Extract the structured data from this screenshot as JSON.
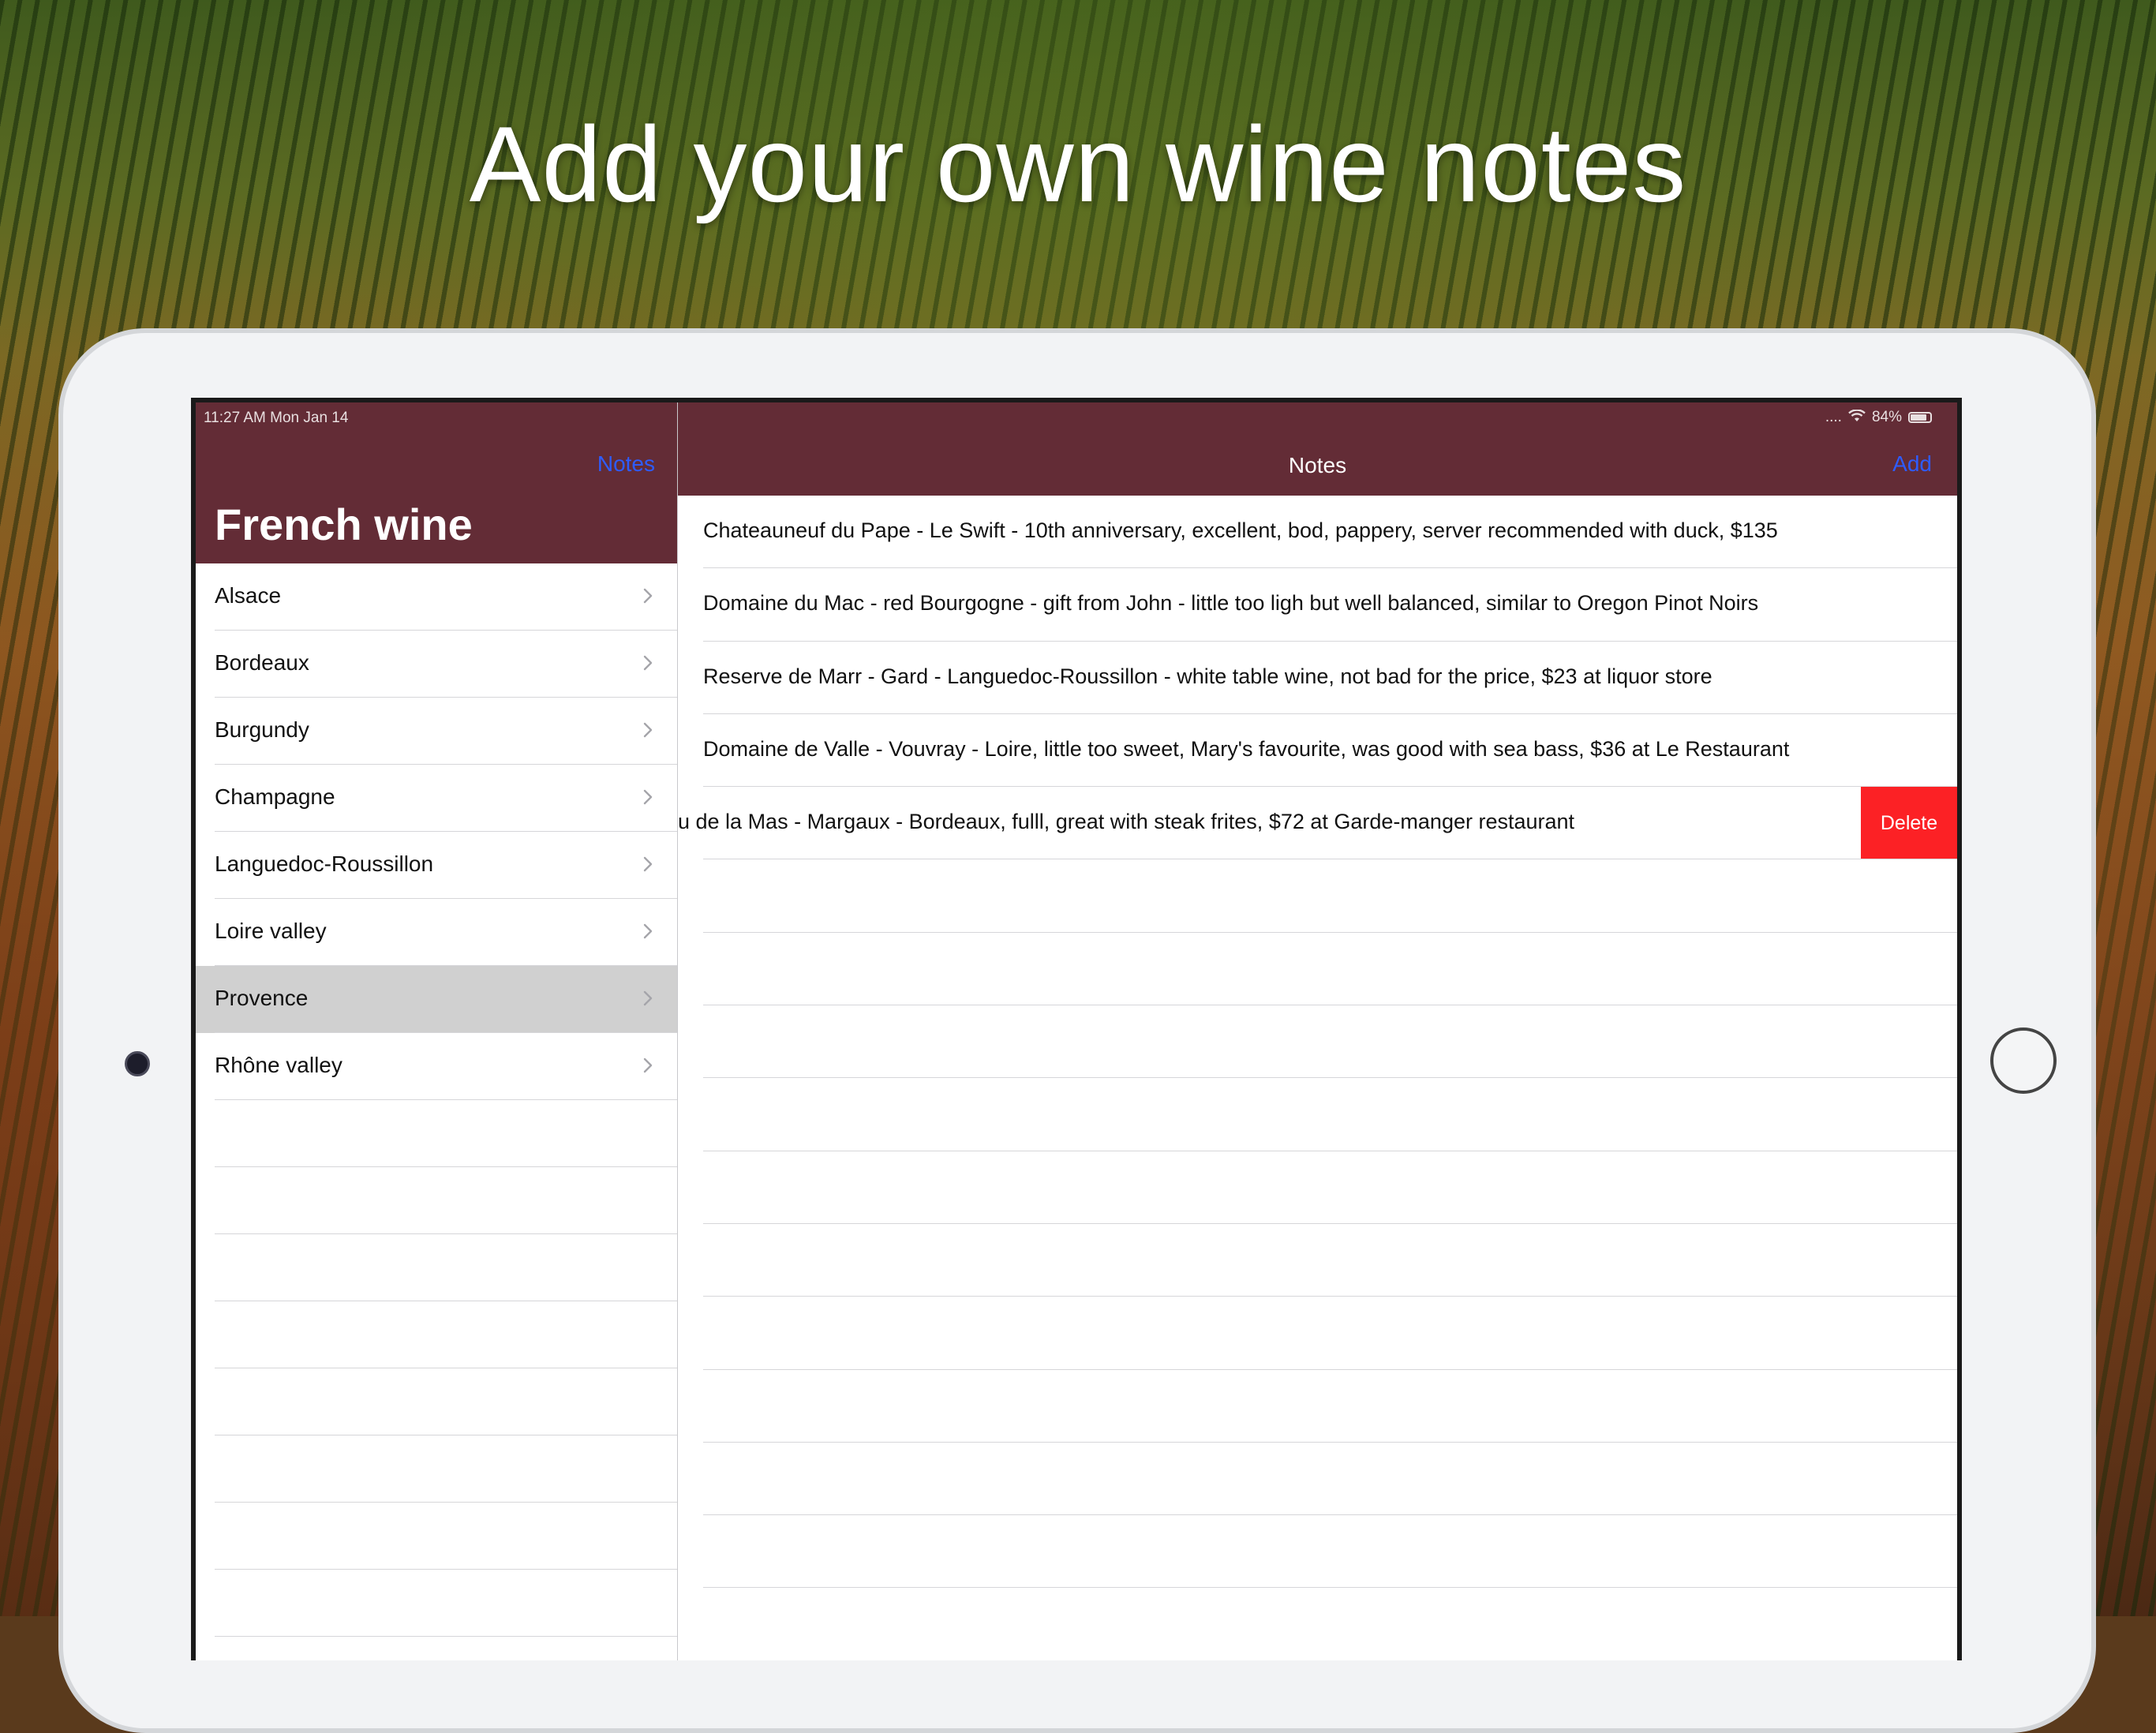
{
  "headline": "Add your own wine notes",
  "status_bar": {
    "time": "11:27 AM   Mon Jan 14",
    "signal_dots": "....",
    "battery_pct": "84%"
  },
  "sidebar": {
    "nav_link": "Notes",
    "title": "French wine",
    "regions": [
      {
        "label": "Alsace",
        "selected": false
      },
      {
        "label": "Bordeaux",
        "selected": false
      },
      {
        "label": "Burgundy",
        "selected": false
      },
      {
        "label": "Champagne",
        "selected": false
      },
      {
        "label": "Languedoc-Roussillon",
        "selected": false
      },
      {
        "label": "Loire valley",
        "selected": false
      },
      {
        "label": "Provence",
        "selected": true
      },
      {
        "label": "Rhône valley",
        "selected": false
      }
    ]
  },
  "detail": {
    "title": "Notes",
    "add_label": "Add",
    "delete_label": "Delete",
    "notes": [
      {
        "text": "Chateauneuf du Pape - Le Swift - 10th  anniversary, excellent, bod, pappery, server recommended with duck, $135",
        "swiped": false
      },
      {
        "text": "Domaine du Mac - red Bourgogne - gift from John - little too ligh but well balanced, similar to Oregon Pinot Noirs",
        "swiped": false
      },
      {
        "text": "Reserve de Marr - Gard - Languedoc-Roussillon - white table wine, not bad for the price, $23 at liquor store",
        "swiped": false
      },
      {
        "text": "Domaine de Valle - Vouvray - Loire, little too sweet, Mary's favourite, was good with sea bass, $36 at Le Restaurant",
        "swiped": false
      },
      {
        "text": "u de la Mas - Margaux - Bordeaux, fulll, great with steak frites, $72 at Garde-manger restaurant",
        "swiped": true
      }
    ]
  },
  "colors": {
    "nav_bar": "#632c36",
    "link_blue": "#2e5cff",
    "delete_red": "#fc2125",
    "selected_row": "#d0d0d0"
  },
  "icons": {
    "chevron": "chevron-right-icon",
    "wifi": "wifi-icon",
    "battery": "battery-icon"
  }
}
